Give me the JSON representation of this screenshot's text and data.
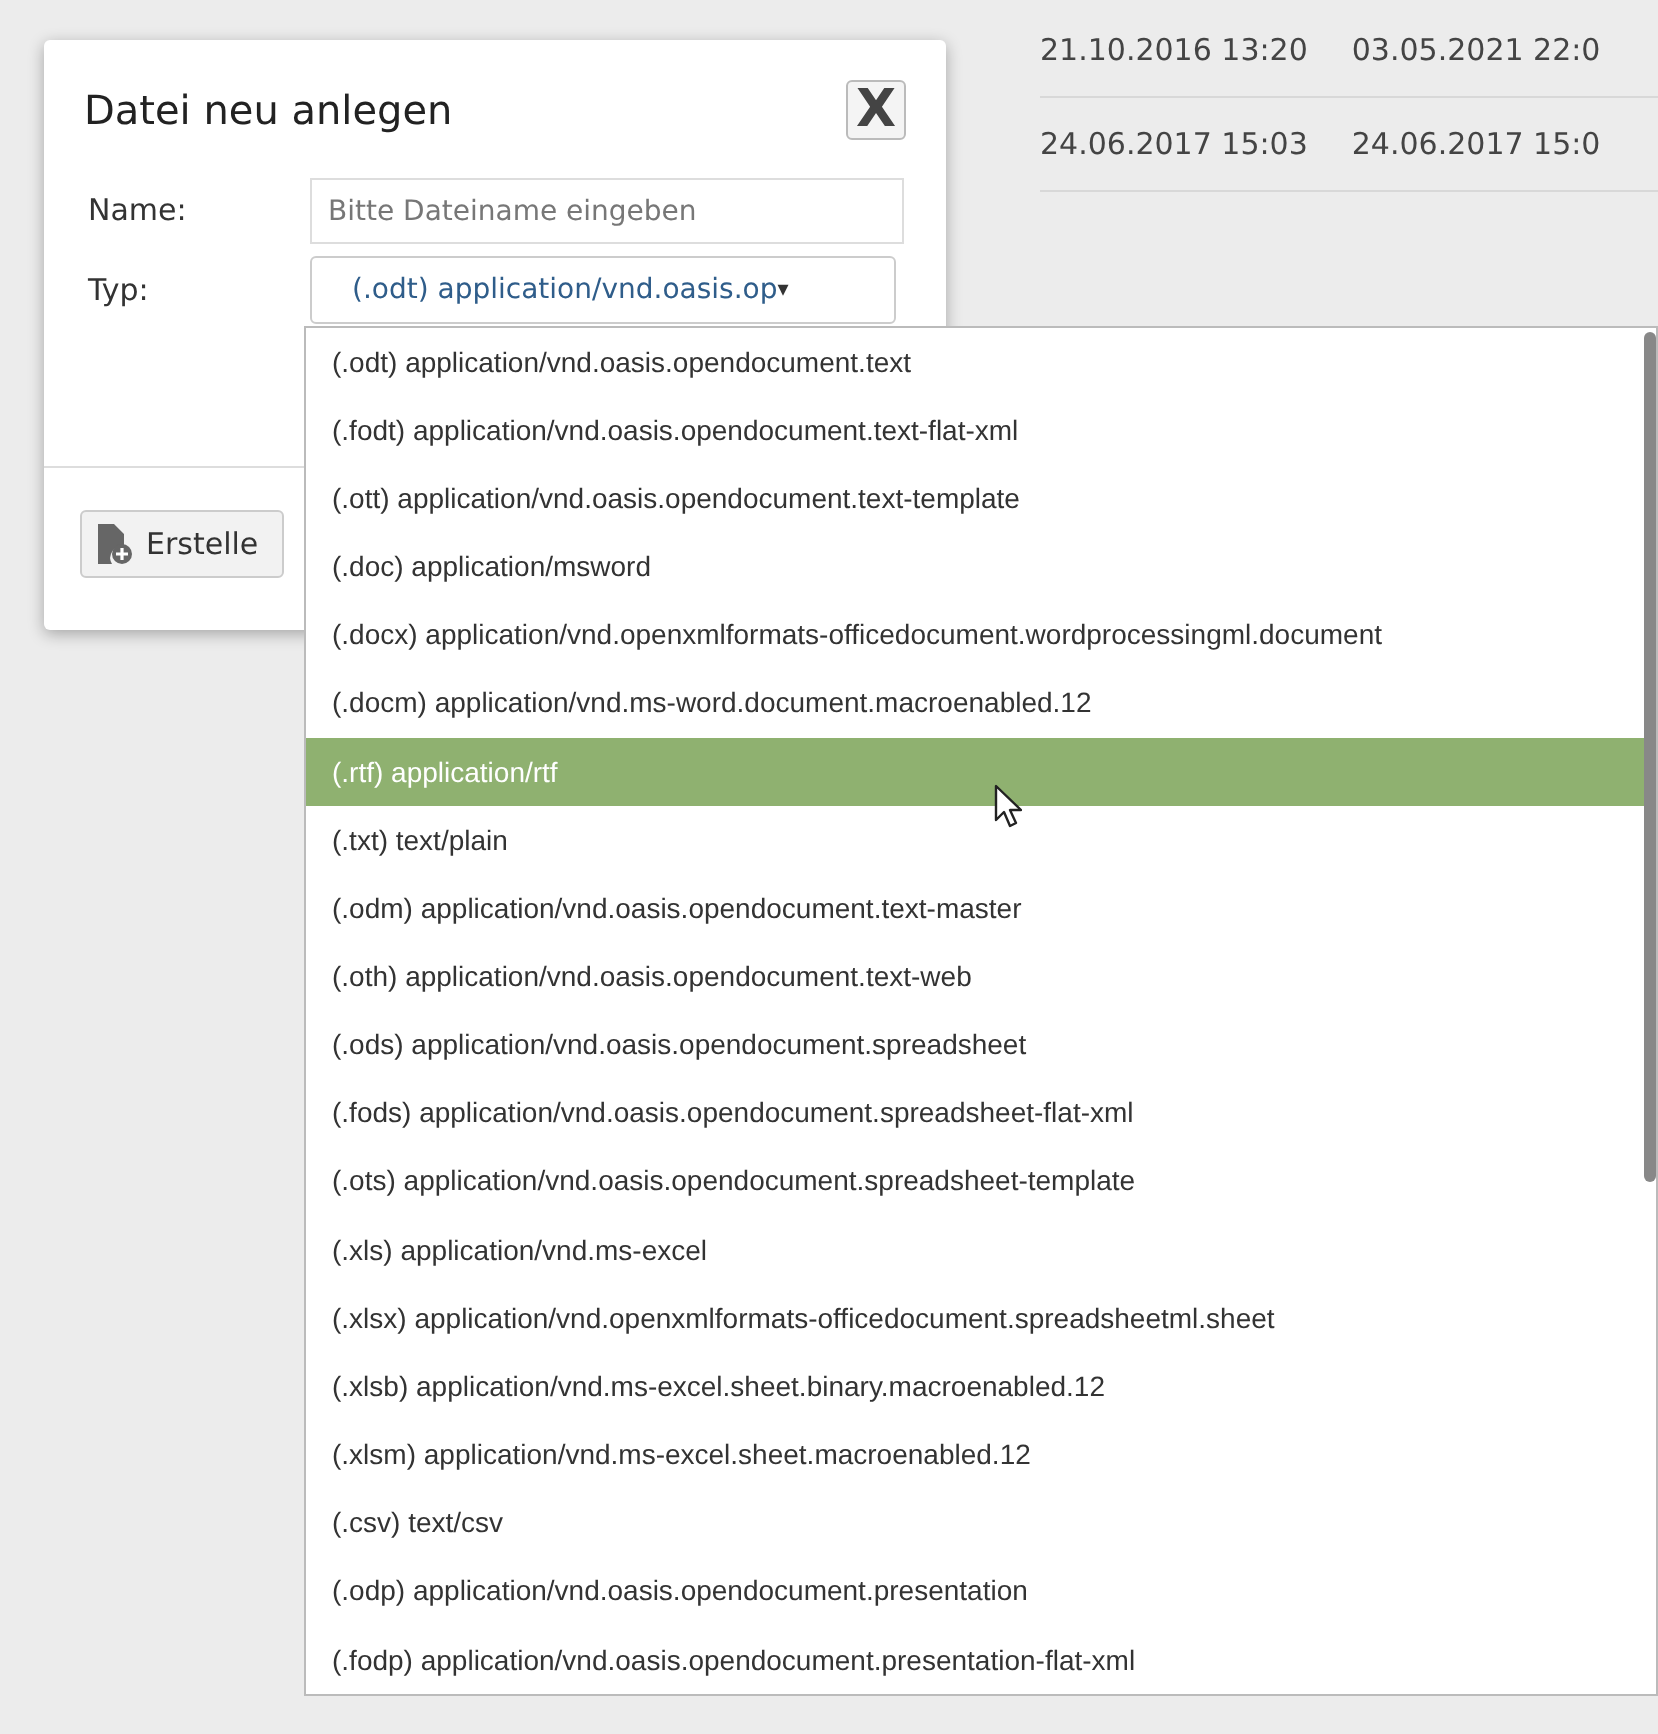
{
  "background_table": {
    "rows": [
      {
        "cells": [
          "21.10.2016 13:20",
          "03.05.2021 22:0"
        ]
      },
      {
        "cells": [
          "24.06.2017 15:03",
          "24.06.2017 15:0"
        ]
      }
    ]
  },
  "dialog": {
    "title": "Datei neu anlegen",
    "close": "X",
    "fields": [
      {
        "kind": "text",
        "label": "Name:",
        "placeholder": "Bitte Dateiname eingeben"
      },
      {
        "kind": "select",
        "label": "Typ:",
        "value": "(.odt) application/vnd.oasis.op",
        "arrow": "▾"
      }
    ],
    "button": "Erstelle"
  },
  "dropdown": {
    "options": [
      {
        "label": "(.odt) application/vnd.oasis.opendocument.text",
        "selected": false
      },
      {
        "label": "(.fodt) application/vnd.oasis.opendocument.text-flat-xml",
        "selected": false
      },
      {
        "label": "(.ott) application/vnd.oasis.opendocument.text-template",
        "selected": false
      },
      {
        "label": "(.doc) application/msword",
        "selected": false
      },
      {
        "label": "(.docx) application/vnd.openxmlformats-officedocument.wordprocessingml.document",
        "selected": false
      },
      {
        "label": "(.docm) application/vnd.ms-word.document.macroenabled.12",
        "selected": false
      },
      {
        "label": "(.rtf) application/rtf",
        "selected": true
      },
      {
        "label": "(.txt) text/plain",
        "selected": false
      },
      {
        "label": "(.odm) application/vnd.oasis.opendocument.text-master",
        "selected": false
      },
      {
        "label": "(.oth) application/vnd.oasis.opendocument.text-web",
        "selected": false
      },
      {
        "label": "(.ods) application/vnd.oasis.opendocument.spreadsheet",
        "selected": false
      },
      {
        "label": "(.fods) application/vnd.oasis.opendocument.spreadsheet-flat-xml",
        "selected": false
      },
      {
        "label": "(.ots) application/vnd.oasis.opendocument.spreadsheet-template",
        "selected": false
      },
      {
        "label": "(.xls) application/vnd.ms-excel",
        "selected": false
      },
      {
        "label": "(.xlsx) application/vnd.openxmlformats-officedocument.spreadsheetml.sheet",
        "selected": false
      },
      {
        "label": "(.xlsb) application/vnd.ms-excel.sheet.binary.macroenabled.12",
        "selected": false
      },
      {
        "label": "(.xlsm) application/vnd.ms-excel.sheet.macroenabled.12",
        "selected": false
      },
      {
        "label": "(.csv) text/csv",
        "selected": false
      },
      {
        "label": "(.odp) application/vnd.oasis.opendocument.presentation",
        "selected": false
      },
      {
        "label": "(.fodp) application/vnd.oasis.opendocument.presentation-flat-xml",
        "selected": false
      }
    ]
  }
}
